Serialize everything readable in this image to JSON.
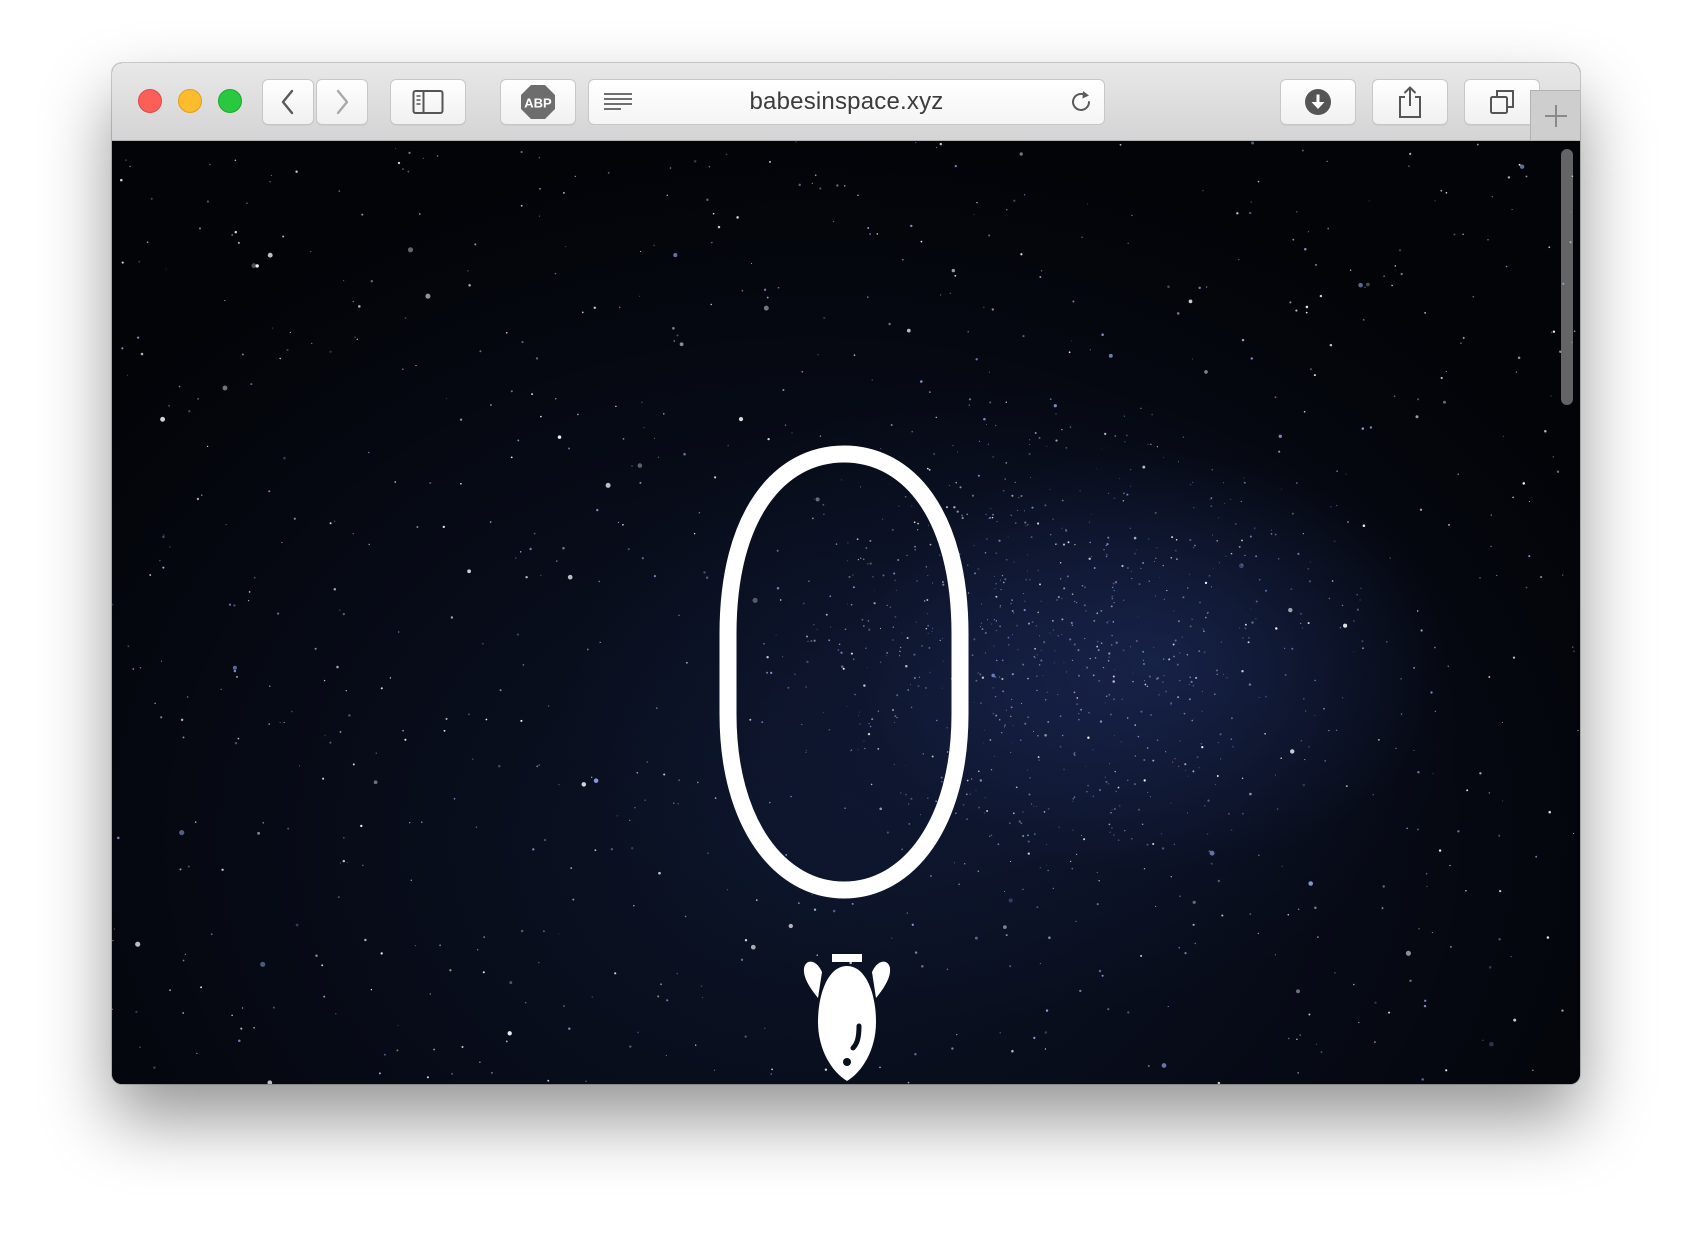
{
  "browser": {
    "url": "babesinspace.xyz",
    "buttons": {
      "back": "back-icon",
      "forward": "forward-icon",
      "sidebar": "sidebar-icon",
      "adblock": "ABP",
      "reader": "reader-icon",
      "reload": "reload-icon",
      "download": "download-icon",
      "share": "share-icon",
      "tabs": "tabs-icon",
      "new_tab": "plus-icon"
    }
  },
  "page": {
    "counter": "0",
    "icon": "bomb-icon",
    "background": "starfield"
  },
  "colors": {
    "close": "#fc5f57",
    "minimize": "#fdbc2e",
    "zoom": "#28c840",
    "text": "#ffffff"
  }
}
